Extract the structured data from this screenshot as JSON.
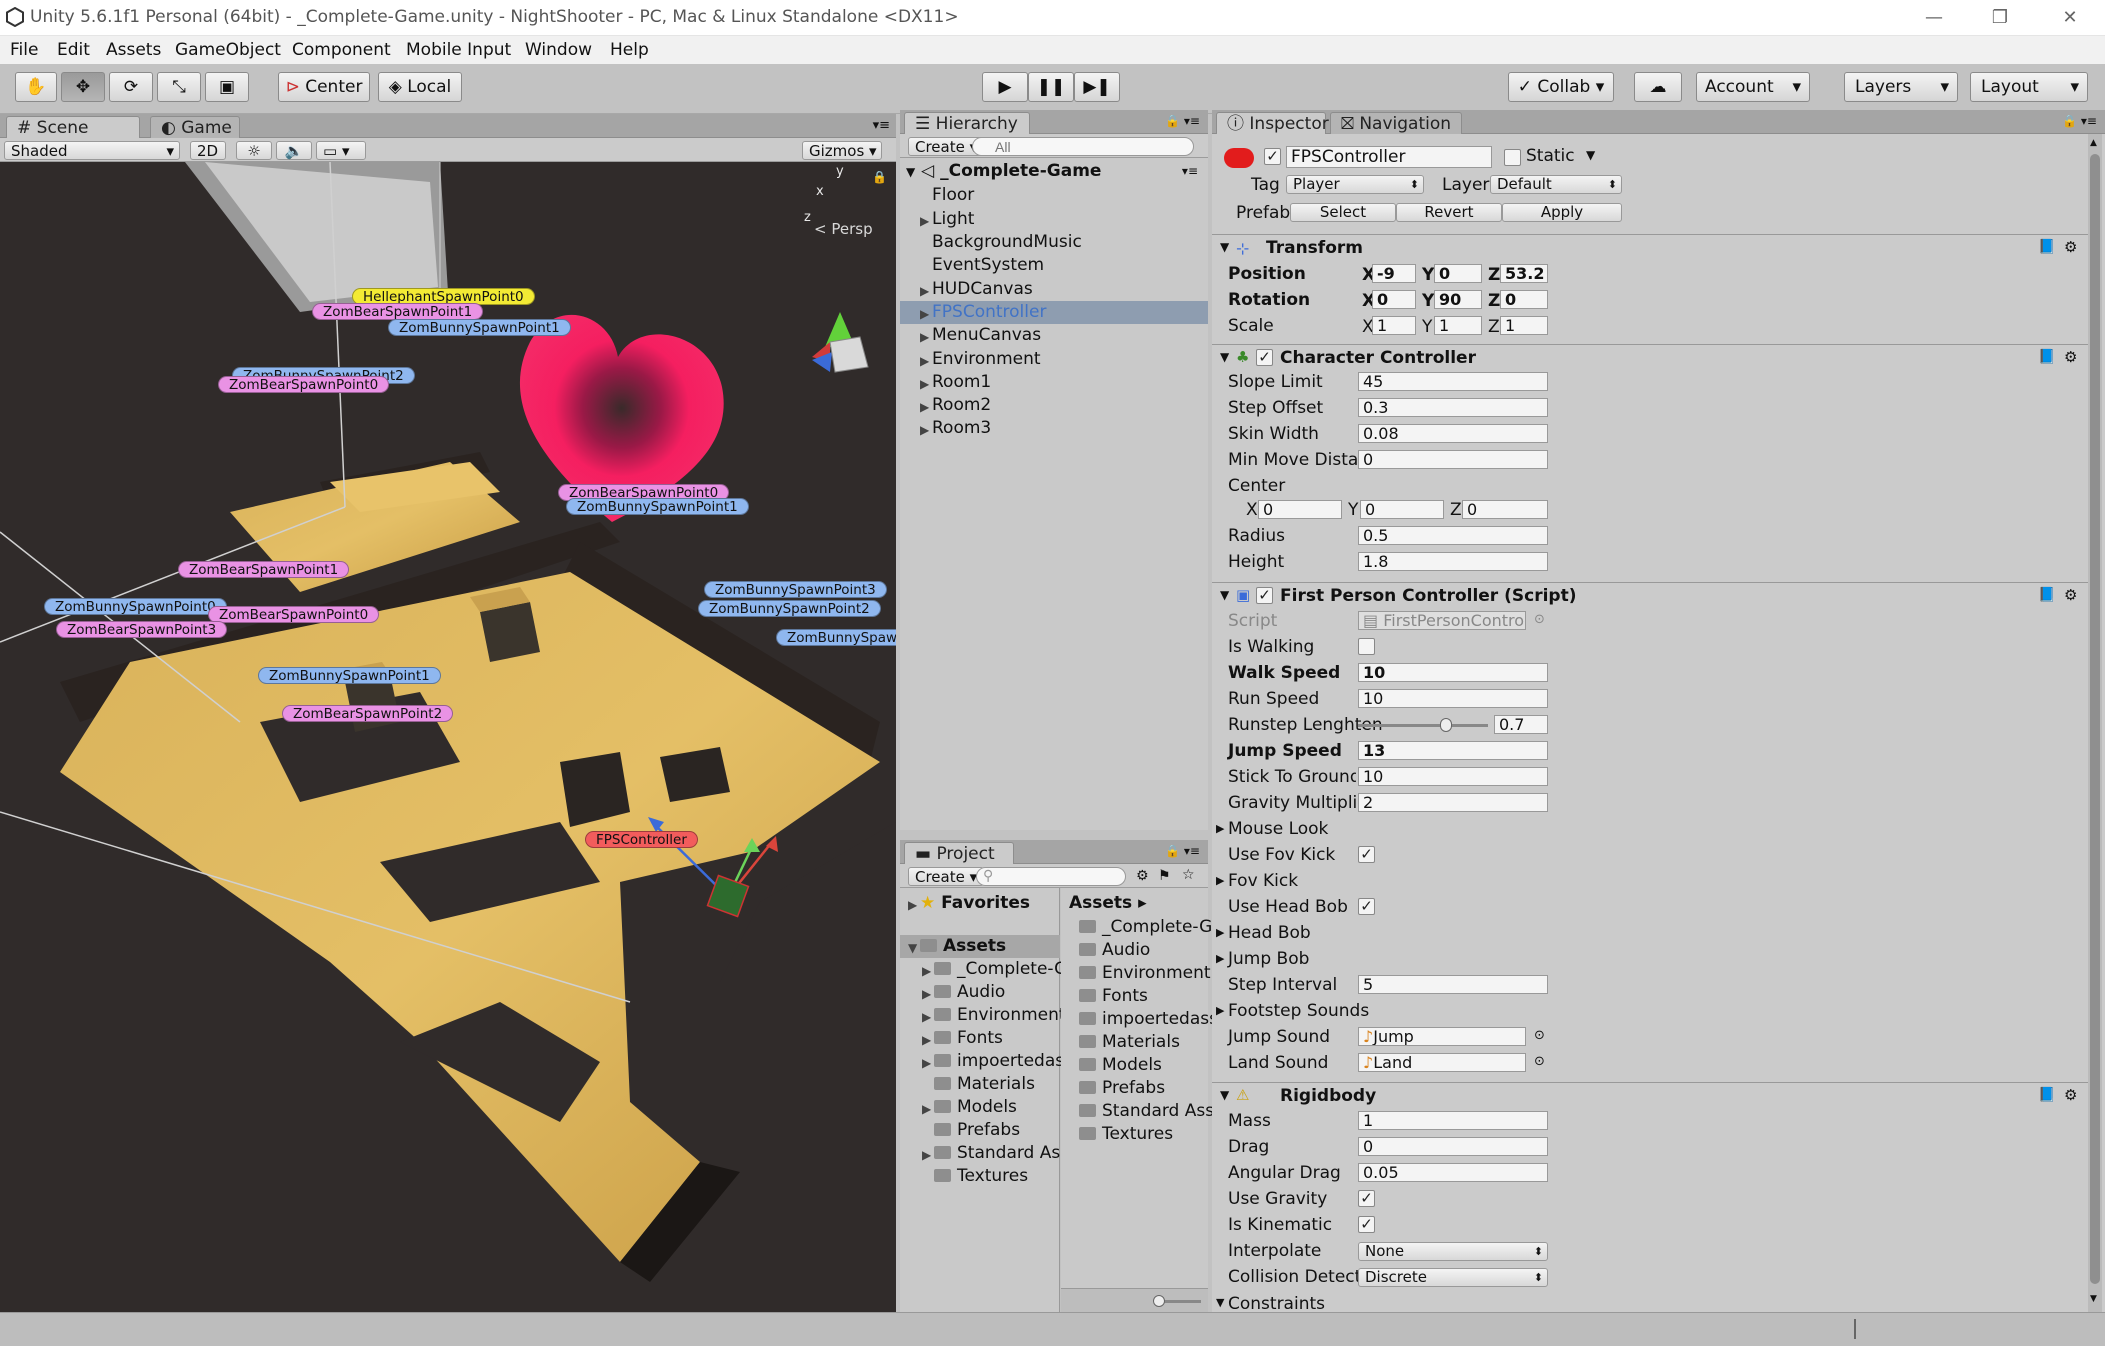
{
  "window": {
    "title": "Unity 5.6.1f1 Personal (64bit) - _Complete-Game.unity - NightShooter - PC, Mac & Linux Standalone <DX11>",
    "controls": [
      "—",
      "❐",
      "✕"
    ]
  },
  "menu": [
    "File",
    "Edit",
    "Assets",
    "GameObject",
    "Component",
    "Mobile Input",
    "Window",
    "Help"
  ],
  "toolbar": {
    "pivot": "Center",
    "space": "Local",
    "collab": "Collab ▾",
    "account": "Account",
    "layers": "Layers",
    "layout": "Layout"
  },
  "scene_panel": {
    "tabs": [
      "Scene",
      "Game"
    ],
    "shading": "Shaded",
    "mode_2d": "2D",
    "gizmos": "Gizmos",
    "search_placeholder": "All",
    "persp": "Persp",
    "axes": [
      "y",
      "x",
      "z"
    ],
    "labels": [
      {
        "text": "HellephantSpawnPoint0",
        "color": "yellow"
      },
      {
        "text": "ZomBearSpawnPoint1",
        "color": "pink"
      },
      {
        "text": "ZomBunnySpawnPoint1",
        "color": "blue"
      },
      {
        "text": "ZomBunnySpawnPoint2",
        "color": "blue"
      },
      {
        "text": "ZomBearSpawnPoint0",
        "color": "pink"
      },
      {
        "text": "ZomBearSpawnPoint0",
        "color": "pink"
      },
      {
        "text": "ZomBunnySpawnPoint1",
        "color": "blue"
      },
      {
        "text": "ZomBearSpawnPoint1",
        "color": "pink"
      },
      {
        "text": "ZomBunnySpawnPoint0",
        "color": "blue"
      },
      {
        "text": "ZomBearSpawnPoint0",
        "color": "pink"
      },
      {
        "text": "ZomBearSpawnPoint3",
        "color": "pink"
      },
      {
        "text": "ZomBunnySpawnPoint3",
        "color": "blue"
      },
      {
        "text": "ZomBunnySpawnPoint2",
        "color": "blue"
      },
      {
        "text": "ZomBunnySpawnPoi",
        "color": "blue"
      },
      {
        "text": "ZomBunnySpawnPoint1",
        "color": "blue"
      },
      {
        "text": "ZomBearSpawnPoint2",
        "color": "pink"
      },
      {
        "text": "FPSController",
        "color": "red"
      }
    ]
  },
  "hierarchy": {
    "tab": "Hierarchy",
    "create": "Create ▾",
    "search_placeholder": "All",
    "scene": "_Complete-Game",
    "items": [
      "Floor",
      "Light",
      "BackgroundMusic",
      "EventSystem",
      "HUDCanvas",
      "FPSController",
      "MenuCanvas",
      "Environment",
      "Room1",
      "Room2",
      "Room3"
    ],
    "selected": "FPSController"
  },
  "project": {
    "tab": "Project",
    "create": "Create ▾",
    "favorites": "Favorites",
    "assets_root": "Assets",
    "tree": [
      "_Complete-Game",
      "Audio",
      "Environment",
      "Fonts",
      "impoertedassets",
      "Materials",
      "Models",
      "Prefabs",
      "Standard Assets",
      "Textures"
    ],
    "breadcrumb": "Assets ▸",
    "list": [
      "_Complete-Game",
      "Audio",
      "Environment",
      "Fonts",
      "impoertedassets",
      "Materials",
      "Models",
      "Prefabs",
      "Standard Assets",
      "Textures"
    ]
  },
  "inspector": {
    "tabs": [
      "Inspector",
      "Navigation"
    ],
    "object_name": "FPSController",
    "static_label": "Static",
    "tag_label": "Tag",
    "tag_value": "Player",
    "layer_label": "Layer",
    "layer_value": "Default",
    "prefab_label": "Prefab",
    "prefab_buttons": [
      "Select",
      "Revert",
      "Apply"
    ],
    "transform": {
      "title": "Transform",
      "position_label": "Position",
      "position": [
        "-9",
        "0",
        "53.2"
      ],
      "rotation_label": "Rotation",
      "rotation": [
        "0",
        "90",
        "0"
      ],
      "scale_label": "Scale",
      "scale": [
        "1",
        "1",
        "1"
      ],
      "axes": [
        "X",
        "Y",
        "Z"
      ]
    },
    "character_controller": {
      "title": "Character Controller",
      "rows": [
        {
          "label": "Slope Limit",
          "value": "45"
        },
        {
          "label": "Step Offset",
          "value": "0.3"
        },
        {
          "label": "Skin Width",
          "value": "0.08"
        },
        {
          "label": "Min Move Distance",
          "value": "0"
        }
      ],
      "center_label": "Center",
      "center": [
        "0",
        "0",
        "0"
      ],
      "rows2": [
        {
          "label": "Radius",
          "value": "0.5"
        },
        {
          "label": "Height",
          "value": "1.8"
        }
      ]
    },
    "fps_controller": {
      "title": "First Person Controller (Script)",
      "script_label": "Script",
      "script_value": "FirstPersonController",
      "is_walking_label": "Is Walking",
      "walk_speed_label": "Walk Speed",
      "walk_speed": "10",
      "run_speed_label": "Run Speed",
      "run_speed": "10",
      "runstep_label": "Runstep Lenghten",
      "runstep": "0.7",
      "runstep_fraction": 0.7,
      "jump_speed_label": "Jump Speed",
      "jump_speed": "13",
      "stick_label": "Stick To Ground Forc",
      "stick": "10",
      "gravity_label": "Gravity Multiplier",
      "gravity": "2",
      "mouse_look_label": "Mouse Look",
      "fov_kick_label": "Use Fov Kick",
      "fov_kick2_label": "Fov Kick",
      "head_bob_label": "Use Head Bob",
      "head_bob2_label": "Head Bob",
      "jump_bob_label": "Jump Bob",
      "step_interval_label": "Step Interval",
      "step_interval": "5",
      "footstep_label": "Footstep Sounds",
      "jump_sound_label": "Jump Sound",
      "jump_sound": "Jump",
      "land_sound_label": "Land Sound",
      "land_sound": "Land"
    },
    "rigidbody": {
      "title": "Rigidbody",
      "mass_label": "Mass",
      "mass": "1",
      "drag_label": "Drag",
      "drag": "0",
      "angular_label": "Angular Drag",
      "angular": "0.05",
      "gravity_label": "Use Gravity",
      "kinematic_label": "Is Kinematic",
      "interpolate_label": "Interpolate",
      "interpolate": "None",
      "collision_label": "Collision Detection",
      "collision": "Discrete",
      "constraints_label": "Constraints"
    }
  },
  "colors": {
    "selection": "#3e7ad6",
    "pink_label": "#e992e4",
    "blue_label": "#8fb7ef",
    "yellow_label": "#f3ea34",
    "heart": "#ff1e63"
  }
}
